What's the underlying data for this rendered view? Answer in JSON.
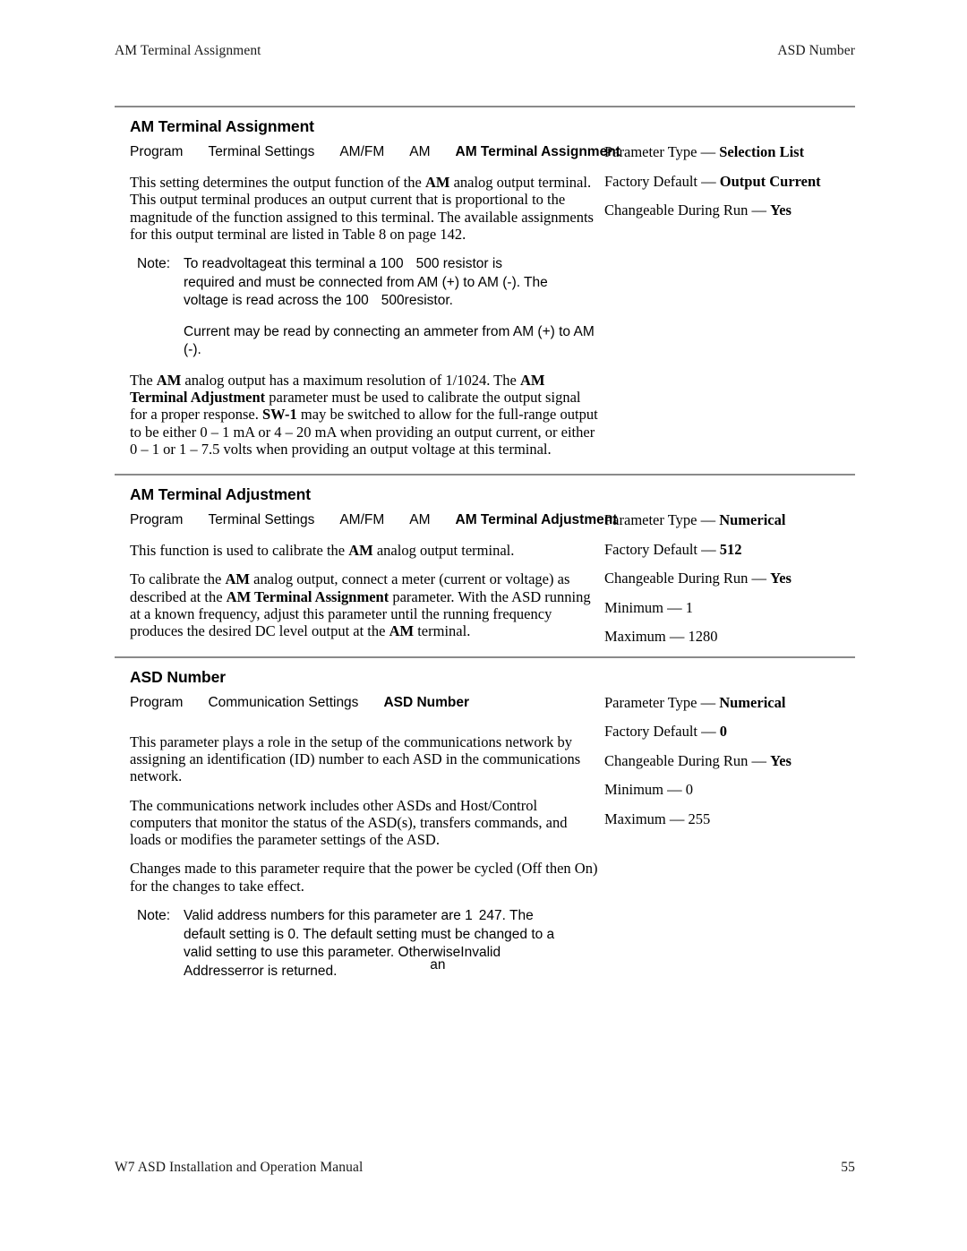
{
  "header": {
    "left": "AM Terminal Assignment",
    "right": "ASD Number"
  },
  "footer": {
    "left": "W7 ASD Installation and Operation Manual",
    "page_number": "55"
  },
  "sections": [
    {
      "heading": "AM Terminal Assignment",
      "breadcrumb": [
        "Program",
        "Terminal Settings",
        "AM/FM",
        "AM",
        "AM Terminal Assignment"
      ],
      "paragraphs": [
        {
          "runs": [
            {
              "text": "This setting determines the output function of the ",
              "bold": false
            },
            {
              "text": "AM",
              "bold": true
            },
            {
              "text": " analog output terminal. This output terminal produces an output current that is proportional to the magnitude of the function assigned to this terminal. The available assignments for this output terminal are listed in Table 8 on page 142.",
              "bold": false
            }
          ]
        }
      ],
      "note": {
        "label": "Note:",
        "line1_a": "To read",
        "line1_b": "voltage",
        "line1_c": "at this terminal a 100",
        "line1_d": "500 resistor is",
        "line2": "required and must be connected from AM (+) to AM (-). The",
        "line3_a": "voltage is read across the 100",
        "line3_b": "500",
        "line3_c": "resistor.",
        "continuation": "Current may be read by connecting an ammeter from AM (+) to AM (-)."
      },
      "paragraphs_after": [
        {
          "runs": [
            {
              "text": "The ",
              "bold": false
            },
            {
              "text": "AM",
              "bold": true
            },
            {
              "text": " analog output has a maximum resolution of 1/1024. The ",
              "bold": false
            },
            {
              "text": "AM Terminal Adjustment",
              "bold": true
            },
            {
              "text": " parameter must be used to calibrate the output signal for a proper response. ",
              "bold": false
            },
            {
              "text": "SW-1",
              "bold": true
            },
            {
              "text": " may be switched to allow for the full-range output to be either 0 – 1 mA or 4 – 20 mA when providing an output current, or either 0 – 1 or 1 – 7.5 volts when providing an output voltage at this terminal.",
              "bold": false
            }
          ]
        }
      ],
      "facts": [
        {
          "label": "Parameter Type —",
          "value": "Selection List",
          "bold": true
        },
        {
          "label": "Factory Default —",
          "value": "Output Current",
          "bold": true
        },
        {
          "label": "Changeable During Run —",
          "value": "Yes",
          "bold": true
        }
      ]
    },
    {
      "heading": "AM Terminal Adjustment",
      "breadcrumb": [
        "Program",
        "Terminal Settings",
        "AM/FM",
        "AM",
        "AM Terminal Adjustment"
      ],
      "paragraphs": [
        {
          "runs": [
            {
              "text": "This function is used to calibrate the ",
              "bold": false
            },
            {
              "text": "AM",
              "bold": true
            },
            {
              "text": " analog output terminal.",
              "bold": false
            }
          ]
        },
        {
          "runs": [
            {
              "text": "To calibrate the ",
              "bold": false
            },
            {
              "text": "AM",
              "bold": true
            },
            {
              "text": " analog output, connect a meter (current or voltage) as described at the ",
              "bold": false
            },
            {
              "text": "AM Terminal Assignment",
              "bold": true
            },
            {
              "text": " parameter. With the ASD running at a known frequency, adjust this parameter until the running frequency produces the desired DC level output at the ",
              "bold": false
            },
            {
              "text": "AM",
              "bold": true
            },
            {
              "text": " terminal.",
              "bold": false
            }
          ]
        }
      ],
      "facts": [
        {
          "label": "Parameter Type —",
          "value": "Numerical",
          "bold": true
        },
        {
          "label": "Factory Default —",
          "value": "512",
          "bold": true
        },
        {
          "label": "Changeable During Run —",
          "value": "Yes",
          "bold": true
        },
        {
          "label": "Minimum —",
          "value": "1",
          "bold": false
        },
        {
          "label": "Maximum —",
          "value": "1280",
          "bold": false
        }
      ]
    },
    {
      "heading": "ASD Number",
      "breadcrumb": [
        "Program",
        "Communication Settings",
        "ASD Number"
      ],
      "paragraphs": [
        {
          "runs": [
            {
              "text": "This parameter plays a role in the setup of the communications network by assigning an identification (ID) number to each ASD in the communications network.",
              "bold": false
            }
          ]
        },
        {
          "runs": [
            {
              "text": "The communications network includes other ASDs and Host/Control computers that monitor the status of the ASD(s), transfers commands, and loads or modifies the parameter settings of the ASD.",
              "bold": false
            }
          ]
        },
        {
          "runs": [
            {
              "text": "Changes made to this parameter require that the power be cycled (Off then On) for the changes to take effect.",
              "bold": false
            }
          ]
        }
      ],
      "note": {
        "label": "Note:",
        "line1_a": "Valid address numbers for this parameter are 1",
        "line1_b": "247. The",
        "line2": "default setting is 0. The default setting must be changed to a",
        "line3_a": "valid setting to use this parameter. Otherwise",
        "line3_overlap": "an",
        "line3_b": "Invalid",
        "line4_a": "Address",
        "line4_b": "error is returned."
      },
      "facts": [
        {
          "label": "Parameter Type —",
          "value": "Numerical",
          "bold": true
        },
        {
          "label": "Factory Default —",
          "value": "0",
          "bold": true
        },
        {
          "label": "Changeable During Run —",
          "value": "Yes",
          "bold": true
        },
        {
          "label": "Minimum —",
          "value": "0",
          "bold": false
        },
        {
          "label": "Maximum —",
          "value": "255",
          "bold": false
        }
      ]
    }
  ]
}
